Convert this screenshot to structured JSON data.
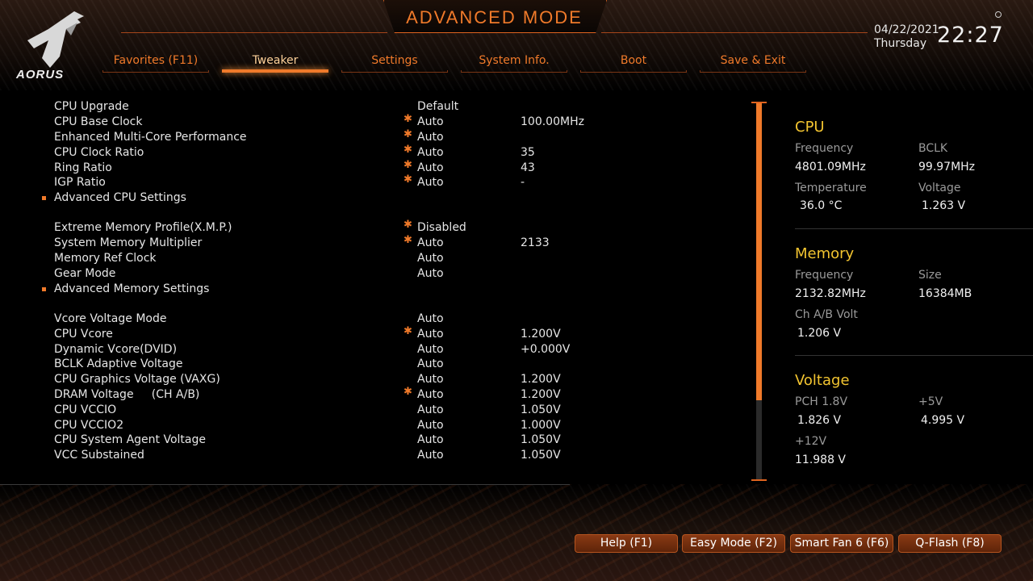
{
  "header": {
    "title": "ADVANCED MODE",
    "brand": "AORUS",
    "date": "04/22/2021",
    "day": "Thursday",
    "time": "22:27"
  },
  "tabs": [
    {
      "label": "Favorites (F11)",
      "active": false
    },
    {
      "label": "Tweaker",
      "active": true
    },
    {
      "label": "Settings",
      "active": false
    },
    {
      "label": "System Info.",
      "active": false
    },
    {
      "label": "Boot",
      "active": false
    },
    {
      "label": "Save & Exit",
      "active": false
    }
  ],
  "settings": [
    {
      "label": "CPU Upgrade",
      "value": "Default",
      "current": "",
      "modified": false,
      "submenu": false
    },
    {
      "label": "CPU Base Clock",
      "value": "Auto",
      "current": "100.00MHz",
      "modified": true,
      "submenu": false
    },
    {
      "label": "Enhanced Multi-Core Performance",
      "value": "Auto",
      "current": "",
      "modified": true,
      "submenu": false
    },
    {
      "label": "CPU Clock Ratio",
      "value": "Auto",
      "current": "35",
      "modified": true,
      "submenu": false
    },
    {
      "label": "Ring Ratio",
      "value": "Auto",
      "current": "43",
      "modified": true,
      "submenu": false
    },
    {
      "label": "IGP Ratio",
      "value": "Auto",
      "current": "-",
      "modified": true,
      "submenu": false
    },
    {
      "label": "Advanced CPU Settings",
      "value": "",
      "current": "",
      "modified": false,
      "submenu": true
    },
    {
      "label": "Extreme Memory Profile(X.M.P.)",
      "value": "Disabled",
      "current": "",
      "modified": true,
      "submenu": false
    },
    {
      "label": "System Memory Multiplier",
      "value": "Auto",
      "current": "2133",
      "modified": true,
      "submenu": false
    },
    {
      "label": "Memory Ref Clock",
      "value": "Auto",
      "current": "",
      "modified": false,
      "submenu": false
    },
    {
      "label": "Gear Mode",
      "value": "Auto",
      "current": "",
      "modified": false,
      "submenu": false
    },
    {
      "label": "Advanced Memory Settings",
      "value": "",
      "current": "",
      "modified": false,
      "submenu": true
    },
    {
      "label": "Vcore Voltage Mode",
      "value": "Auto",
      "current": "",
      "modified": false,
      "submenu": false
    },
    {
      "label": "CPU Vcore",
      "value": "Auto",
      "current": "1.200V",
      "modified": true,
      "submenu": false
    },
    {
      "label": "Dynamic Vcore(DVID)",
      "value": "Auto",
      "current": "+0.000V",
      "modified": false,
      "submenu": false
    },
    {
      "label": "BCLK Adaptive Voltage",
      "value": "Auto",
      "current": "",
      "modified": false,
      "submenu": false
    },
    {
      "label": "CPU Graphics Voltage (VAXG)",
      "value": "Auto",
      "current": "1.200V",
      "modified": false,
      "submenu": false
    },
    {
      "label": "DRAM Voltage     (CH A/B)",
      "value": "Auto",
      "current": "1.200V",
      "modified": true,
      "submenu": false
    },
    {
      "label": "CPU VCCIO",
      "value": "Auto",
      "current": "1.050V",
      "modified": false,
      "submenu": false
    },
    {
      "label": "CPU VCCIO2",
      "value": "Auto",
      "current": "1.000V",
      "modified": false,
      "submenu": false
    },
    {
      "label": "CPU System Agent Voltage",
      "value": "Auto",
      "current": "1.050V",
      "modified": false,
      "submenu": false
    },
    {
      "label": "VCC Substained",
      "value": "Auto",
      "current": "1.050V",
      "modified": false,
      "submenu": false
    }
  ],
  "scroll": {
    "position_fraction": 0.79
  },
  "info": {
    "cpu": {
      "title": "CPU",
      "freq_label": "Frequency",
      "freq": "4801.09MHz",
      "bclk_label": "BCLK",
      "bclk": "99.97MHz",
      "temp_label": "Temperature",
      "temp": "36.0 °C",
      "volt_label": "Voltage",
      "volt": "1.263 V"
    },
    "memory": {
      "title": "Memory",
      "freq_label": "Frequency",
      "freq": "2132.82MHz",
      "size_label": "Size",
      "size": "16384MB",
      "volt_label": "Ch A/B Volt",
      "volt": "1.206 V"
    },
    "voltage": {
      "title": "Voltage",
      "pch_label": "PCH 1.8V",
      "pch": "1.826 V",
      "v5_label": "+5V",
      "v5": "4.995 V",
      "v12_label": "+12V",
      "v12": "11.988 V"
    }
  },
  "buttons": {
    "help": "Help (F1)",
    "easy": "Easy Mode (F2)",
    "fan": "Smart Fan 6 (F6)",
    "qflash": "Q-Flash (F8)"
  },
  "colors": {
    "accent": "#f07a2a",
    "section_title": "#f2c430",
    "background": "#000000"
  }
}
